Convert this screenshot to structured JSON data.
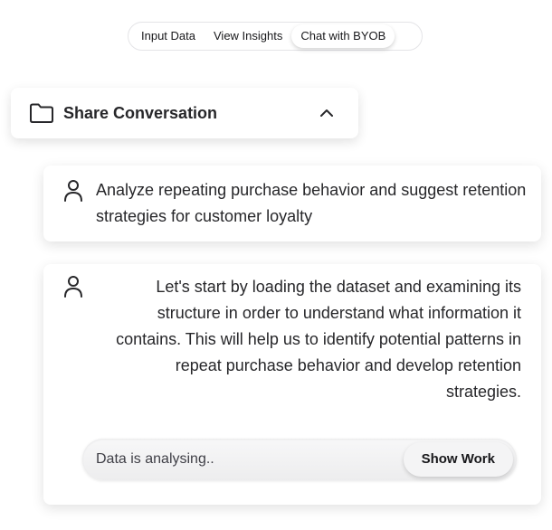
{
  "tabs": [
    {
      "label": "Input Data",
      "active": false
    },
    {
      "label": "View Insights",
      "active": false
    },
    {
      "label": "Chat with BYOB",
      "active": true
    }
  ],
  "share": {
    "title": "Share Conversation",
    "folder_icon": "folder-icon",
    "toggle_icon": "chevron-up-icon"
  },
  "messages": [
    {
      "role": "user",
      "icon": "user-icon",
      "text": "Analyze repeating purchase behavior and suggest retention strategies for customer loyalty"
    },
    {
      "role": "assistant",
      "icon": "user-icon",
      "text": "Let's start by loading the dataset and examining its structure in order to understand what information it contains. This will help us to identify potential patterns in repeat purchase behavior and develop retention strategies."
    }
  ],
  "status": {
    "text": "Data is analysing..",
    "button_label": "Show Work"
  },
  "colors": {
    "text": "#27272a",
    "border": "#e4e4e7",
    "background": "#ffffff"
  }
}
